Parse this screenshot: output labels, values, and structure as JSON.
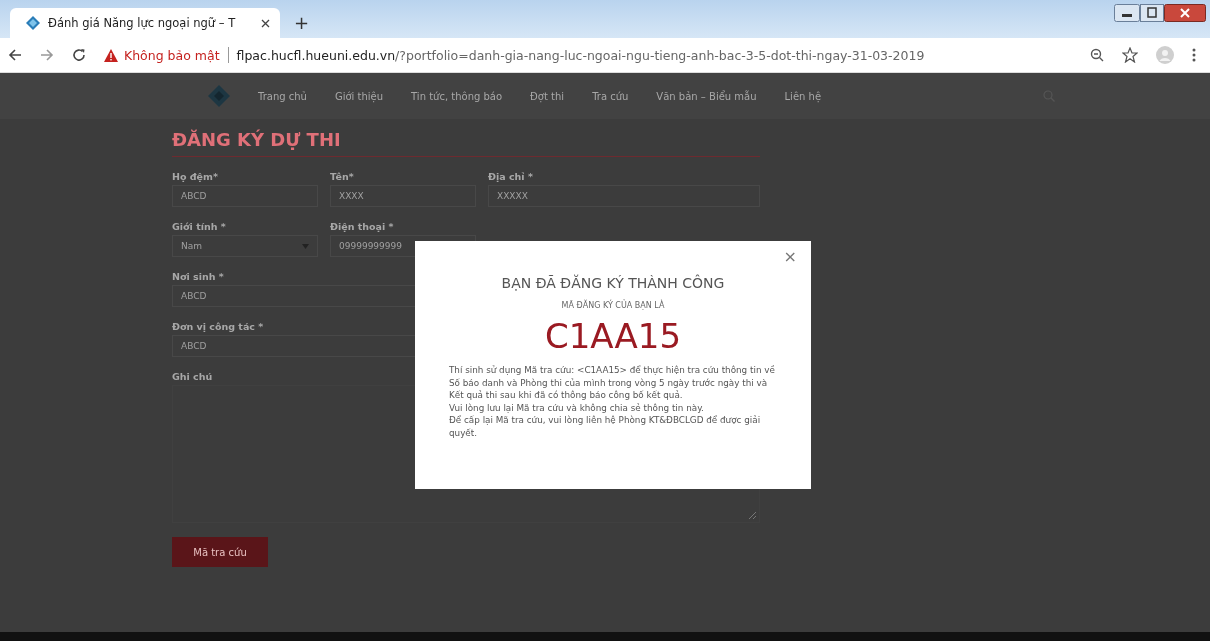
{
  "browser": {
    "tab_title": "Đánh giá Năng lực ngoại ngữ – T",
    "new_tab": "+",
    "security": "Không bảo mật",
    "url_host": "flpac.hucfl.hueuni.edu.vn",
    "url_path": "/?portfolio=danh-gia-nang-luc-ngoai-ngu-tieng-anh-bac-3-5-dot-thi-ngay-31-03-2019"
  },
  "nav": [
    {
      "label": "Trang chủ"
    },
    {
      "label": "Giới thiệu"
    },
    {
      "label": "Tin tức, thông báo"
    },
    {
      "label": "Đợt thi"
    },
    {
      "label": "Tra cứu"
    },
    {
      "label": "Văn bản – Biểu mẫu"
    },
    {
      "label": "Liên hệ"
    }
  ],
  "heading": "ĐĂNG KÝ DỰ THI",
  "form_rows": [
    {
      "fields": [
        {
          "label": "Họ đệm*",
          "value": "ABCD",
          "kind": "text"
        },
        {
          "label": "Tên*",
          "value": "XXXX",
          "kind": "text"
        },
        {
          "label": "Địa chỉ *",
          "value": "XXXXX",
          "kind": "text"
        }
      ]
    },
    {
      "fields": [
        {
          "label": "Giới tính *",
          "value": "Nam",
          "kind": "select"
        },
        {
          "label": "Điện thoại *",
          "value": "09999999999",
          "kind": "text"
        }
      ]
    },
    {
      "fields": [
        {
          "label": "Nơi sinh *",
          "value": "ABCD",
          "kind": "text"
        }
      ]
    },
    {
      "fields": [
        {
          "label": "Đơn vị công tác *",
          "value": "ABCD",
          "kind": "text"
        }
      ]
    },
    {
      "fields": [
        {
          "label": "Ghi chú",
          "kind": "textarea"
        }
      ]
    }
  ],
  "submit_button": "Mã tra cứu",
  "modal": {
    "close": "×",
    "title": "BẠN ĐÃ ĐĂNG KÝ THÀNH CÔNG",
    "subtitle": "MÃ ĐĂNG KÝ CỦA BẠN LÀ",
    "code": "C1AA15",
    "message": "Thí sinh sử dụng Mã tra cứu: <C1AA15> để thực hiện tra cứu thông tin về Số báo danh và Phòng thi của mình trong vòng 5 ngày trước ngày thi và Kết quả thi sau khi đã có thông báo công bố kết quả.\nVui lòng lưu lại Mã tra cứu và không chia sẻ thông tin này.\nĐể cấp lại Mã tra cứu, vui lòng liên hệ Phòng KT&ĐBCLGD để được giải quyết."
  }
}
